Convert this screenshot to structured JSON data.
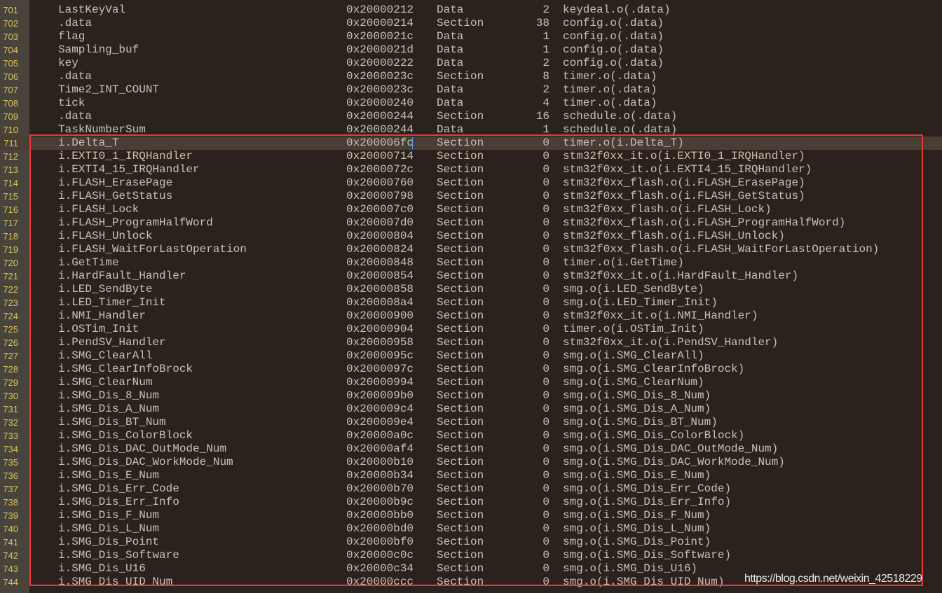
{
  "editor": {
    "colors": {
      "background": "#2b221e",
      "gutter": "#48443c",
      "line_number": "#d9c25a",
      "text": "#c9c1b3",
      "highlight_row": "#4a3d34",
      "annotation_box": "#e8383a",
      "caret": "#4aa3ff"
    },
    "current_line": "711",
    "rows": [
      {
        "line": "701",
        "name": "LastKeyVal",
        "addr": "0x20000212",
        "type": "Data",
        "size": "2",
        "obj": "keydeal.o(.data)"
      },
      {
        "line": "702",
        "name": ".data",
        "addr": "0x20000214",
        "type": "Section",
        "size": "38",
        "obj": "config.o(.data)"
      },
      {
        "line": "703",
        "name": "flag",
        "addr": "0x2000021c",
        "type": "Data",
        "size": "1",
        "obj": "config.o(.data)"
      },
      {
        "line": "704",
        "name": "Sampling_buf",
        "addr": "0x2000021d",
        "type": "Data",
        "size": "1",
        "obj": "config.o(.data)"
      },
      {
        "line": "705",
        "name": "key",
        "addr": "0x20000222",
        "type": "Data",
        "size": "2",
        "obj": "config.o(.data)"
      },
      {
        "line": "706",
        "name": ".data",
        "addr": "0x2000023c",
        "type": "Section",
        "size": "8",
        "obj": "timer.o(.data)"
      },
      {
        "line": "707",
        "name": "Time2_INT_COUNT",
        "addr": "0x2000023c",
        "type": "Data",
        "size": "2",
        "obj": "timer.o(.data)"
      },
      {
        "line": "708",
        "name": "tick",
        "addr": "0x20000240",
        "type": "Data",
        "size": "4",
        "obj": "timer.o(.data)"
      },
      {
        "line": "709",
        "name": ".data",
        "addr": "0x20000244",
        "type": "Section",
        "size": "16",
        "obj": "schedule.o(.data)"
      },
      {
        "line": "710",
        "name": "TaskNumberSum",
        "addr": "0x20000244",
        "type": "Data",
        "size": "1",
        "obj": "schedule.o(.data)"
      },
      {
        "line": "711",
        "name": "i.Delta_T",
        "addr": "0x200006fc",
        "type": "Section",
        "size": "0",
        "obj": "timer.o(i.Delta_T)"
      },
      {
        "line": "712",
        "name": "i.EXTI0_1_IRQHandler",
        "addr": "0x20000714",
        "type": "Section",
        "size": "0",
        "obj": "stm32f0xx_it.o(i.EXTI0_1_IRQHandler)"
      },
      {
        "line": "713",
        "name": "i.EXTI4_15_IRQHandler",
        "addr": "0x2000072c",
        "type": "Section",
        "size": "0",
        "obj": "stm32f0xx_it.o(i.EXTI4_15_IRQHandler)"
      },
      {
        "line": "714",
        "name": "i.FLASH_ErasePage",
        "addr": "0x20000760",
        "type": "Section",
        "size": "0",
        "obj": "stm32f0xx_flash.o(i.FLASH_ErasePage)"
      },
      {
        "line": "715",
        "name": "i.FLASH_GetStatus",
        "addr": "0x20000798",
        "type": "Section",
        "size": "0",
        "obj": "stm32f0xx_flash.o(i.FLASH_GetStatus)"
      },
      {
        "line": "716",
        "name": "i.FLASH_Lock",
        "addr": "0x200007c0",
        "type": "Section",
        "size": "0",
        "obj": "stm32f0xx_flash.o(i.FLASH_Lock)"
      },
      {
        "line": "717",
        "name": "i.FLASH_ProgramHalfWord",
        "addr": "0x200007d0",
        "type": "Section",
        "size": "0",
        "obj": "stm32f0xx_flash.o(i.FLASH_ProgramHalfWord)"
      },
      {
        "line": "718",
        "name": "i.FLASH_Unlock",
        "addr": "0x20000804",
        "type": "Section",
        "size": "0",
        "obj": "stm32f0xx_flash.o(i.FLASH_Unlock)"
      },
      {
        "line": "719",
        "name": "i.FLASH_WaitForLastOperation",
        "addr": "0x20000824",
        "type": "Section",
        "size": "0",
        "obj": "stm32f0xx_flash.o(i.FLASH_WaitForLastOperation)"
      },
      {
        "line": "720",
        "name": "i.GetTime",
        "addr": "0x20000848",
        "type": "Section",
        "size": "0",
        "obj": "timer.o(i.GetTime)"
      },
      {
        "line": "721",
        "name": "i.HardFault_Handler",
        "addr": "0x20000854",
        "type": "Section",
        "size": "0",
        "obj": "stm32f0xx_it.o(i.HardFault_Handler)"
      },
      {
        "line": "722",
        "name": "i.LED_SendByte",
        "addr": "0x20000858",
        "type": "Section",
        "size": "0",
        "obj": "smg.o(i.LED_SendByte)"
      },
      {
        "line": "723",
        "name": "i.LED_Timer_Init",
        "addr": "0x200008a4",
        "type": "Section",
        "size": "0",
        "obj": "smg.o(i.LED_Timer_Init)"
      },
      {
        "line": "724",
        "name": "i.NMI_Handler",
        "addr": "0x20000900",
        "type": "Section",
        "size": "0",
        "obj": "stm32f0xx_it.o(i.NMI_Handler)"
      },
      {
        "line": "725",
        "name": "i.OSTim_Init",
        "addr": "0x20000904",
        "type": "Section",
        "size": "0",
        "obj": "timer.o(i.OSTim_Init)"
      },
      {
        "line": "726",
        "name": "i.PendSV_Handler",
        "addr": "0x20000958",
        "type": "Section",
        "size": "0",
        "obj": "stm32f0xx_it.o(i.PendSV_Handler)"
      },
      {
        "line": "727",
        "name": "i.SMG_ClearAll",
        "addr": "0x2000095c",
        "type": "Section",
        "size": "0",
        "obj": "smg.o(i.SMG_ClearAll)"
      },
      {
        "line": "728",
        "name": "i.SMG_ClearInfoBrock",
        "addr": "0x2000097c",
        "type": "Section",
        "size": "0",
        "obj": "smg.o(i.SMG_ClearInfoBrock)"
      },
      {
        "line": "729",
        "name": "i.SMG_ClearNum",
        "addr": "0x20000994",
        "type": "Section",
        "size": "0",
        "obj": "smg.o(i.SMG_ClearNum)"
      },
      {
        "line": "730",
        "name": "i.SMG_Dis_8_Num",
        "addr": "0x200009b0",
        "type": "Section",
        "size": "0",
        "obj": "smg.o(i.SMG_Dis_8_Num)"
      },
      {
        "line": "731",
        "name": "i.SMG_Dis_A_Num",
        "addr": "0x200009c4",
        "type": "Section",
        "size": "0",
        "obj": "smg.o(i.SMG_Dis_A_Num)"
      },
      {
        "line": "732",
        "name": "i.SMG_Dis_BT_Num",
        "addr": "0x200009e4",
        "type": "Section",
        "size": "0",
        "obj": "smg.o(i.SMG_Dis_BT_Num)"
      },
      {
        "line": "733",
        "name": "i.SMG_Dis_ColorBlock",
        "addr": "0x20000a0c",
        "type": "Section",
        "size": "0",
        "obj": "smg.o(i.SMG_Dis_ColorBlock)"
      },
      {
        "line": "734",
        "name": "i.SMG_Dis_DAC_OutMode_Num",
        "addr": "0x20000af4",
        "type": "Section",
        "size": "0",
        "obj": "smg.o(i.SMG_Dis_DAC_OutMode_Num)"
      },
      {
        "line": "735",
        "name": "i.SMG_Dis_DAC_WorkMode_Num",
        "addr": "0x20000b10",
        "type": "Section",
        "size": "0",
        "obj": "smg.o(i.SMG_Dis_DAC_WorkMode_Num)"
      },
      {
        "line": "736",
        "name": "i.SMG_Dis_E_Num",
        "addr": "0x20000b34",
        "type": "Section",
        "size": "0",
        "obj": "smg.o(i.SMG_Dis_E_Num)"
      },
      {
        "line": "737",
        "name": "i.SMG_Dis_Err_Code",
        "addr": "0x20000b70",
        "type": "Section",
        "size": "0",
        "obj": "smg.o(i.SMG_Dis_Err_Code)"
      },
      {
        "line": "738",
        "name": "i.SMG_Dis_Err_Info",
        "addr": "0x20000b9c",
        "type": "Section",
        "size": "0",
        "obj": "smg.o(i.SMG_Dis_Err_Info)"
      },
      {
        "line": "739",
        "name": "i.SMG_Dis_F_Num",
        "addr": "0x20000bb0",
        "type": "Section",
        "size": "0",
        "obj": "smg.o(i.SMG_Dis_F_Num)"
      },
      {
        "line": "740",
        "name": "i.SMG_Dis_L_Num",
        "addr": "0x20000bd0",
        "type": "Section",
        "size": "0",
        "obj": "smg.o(i.SMG_Dis_L_Num)"
      },
      {
        "line": "741",
        "name": "i.SMG_Dis_Point",
        "addr": "0x20000bf0",
        "type": "Section",
        "size": "0",
        "obj": "smg.o(i.SMG_Dis_Point)"
      },
      {
        "line": "742",
        "name": "i.SMG_Dis_Software",
        "addr": "0x20000c0c",
        "type": "Section",
        "size": "0",
        "obj": "smg.o(i.SMG_Dis_Software)"
      },
      {
        "line": "743",
        "name": "i.SMG_Dis_U16",
        "addr": "0x20000c34",
        "type": "Section",
        "size": "0",
        "obj": "smg.o(i.SMG_Dis_U16)"
      },
      {
        "line": "744",
        "name": "i.SMG_Dis_UID_Num",
        "addr": "0x20000ccc",
        "type": "Section",
        "size": "0",
        "obj": "smg.o(i.SMG_Dis_UID_Num)"
      }
    ]
  },
  "watermark": "https://blog.csdn.net/weixin_42518229"
}
